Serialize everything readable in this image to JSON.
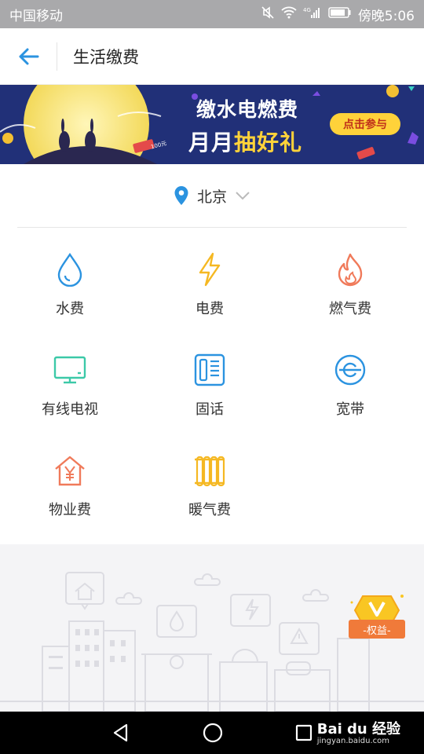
{
  "status_bar": {
    "carrier": "中国移动",
    "network": "4G",
    "time": "傍晚5:06"
  },
  "header": {
    "title": "生活缴费"
  },
  "banner": {
    "line1": "缴水电燃费",
    "line2_prefix": "月月",
    "line2_highlight": "抽好礼",
    "button": "点击参与",
    "tag": "100元"
  },
  "location": {
    "city": "北京"
  },
  "services": [
    {
      "label": "水费",
      "icon": "water-drop-icon",
      "color": "#2b93e0"
    },
    {
      "label": "电费",
      "icon": "lightning-icon",
      "color": "#f5b822"
    },
    {
      "label": "燃气费",
      "icon": "flame-icon",
      "color": "#f07a5a"
    },
    {
      "label": "有线电视",
      "icon": "tv-icon",
      "color": "#3cc9a8"
    },
    {
      "label": "固话",
      "icon": "telephone-icon",
      "color": "#2b93e0"
    },
    {
      "label": "宽带",
      "icon": "broadband-icon",
      "color": "#2b93e0"
    },
    {
      "label": "物业费",
      "icon": "house-yuan-icon",
      "color": "#f07a5a"
    },
    {
      "label": "暖气费",
      "icon": "radiator-icon",
      "color": "#f5b822"
    }
  ],
  "rights": {
    "label": "-权益-"
  },
  "watermark": {
    "brand": "Bai du 经验",
    "url": "jingyan.baidu.com"
  }
}
